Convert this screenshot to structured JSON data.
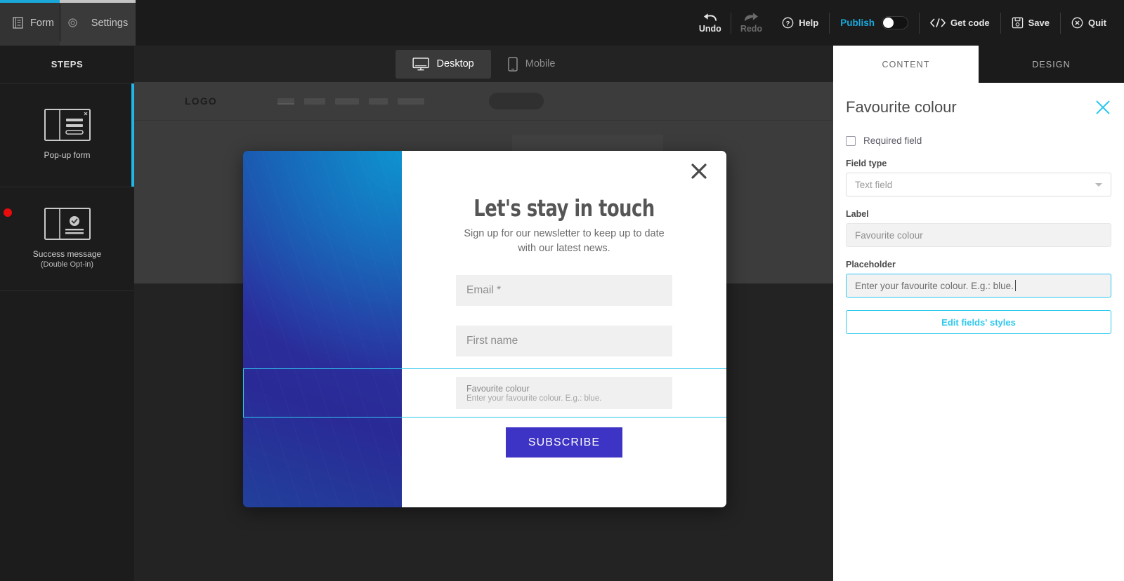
{
  "topbar": {
    "tabs": [
      {
        "label": "Form",
        "icon": "document-icon"
      },
      {
        "label": "Settings",
        "icon": "gear-icon"
      }
    ],
    "tools": [
      {
        "label": "Undo",
        "icon": "undo-arrow-icon"
      },
      {
        "label": "Redo",
        "icon": "redo-arrow-icon"
      },
      {
        "label": "Help",
        "icon": "help-circle-icon"
      },
      {
        "label": "Get code",
        "icon": "code-brackets-icon"
      },
      {
        "label": "Save",
        "icon": "floppy-disk-icon"
      },
      {
        "label": "Quit",
        "icon": "close-circle-icon"
      }
    ],
    "publish": {
      "label": "Publish",
      "state": "off"
    }
  },
  "sidebar": {
    "title": "STEPS",
    "items": [
      {
        "label": "Pop-up form",
        "sublabel": "",
        "icon": "popup-form-icon",
        "active": true,
        "has_alert": false
      },
      {
        "label": "Success message",
        "sublabel": "(Double Opt-in)",
        "icon": "success-check-icon",
        "active": false,
        "has_alert": true
      }
    ]
  },
  "canvas": {
    "device_switch": [
      {
        "label": "Desktop",
        "icon": "monitor-icon",
        "active": true
      },
      {
        "label": "Mobile",
        "icon": "phone-icon",
        "active": false
      }
    ],
    "mock_site": {
      "logo": "LOGO"
    }
  },
  "popup": {
    "title": "Let's stay in touch",
    "subtitle": "Sign up for our newsletter to keep up to date with our latest news.",
    "close_icon": "close-x-icon",
    "fields": [
      {
        "placeholder": "Email *",
        "label": "",
        "selected": false
      },
      {
        "placeholder": "First name",
        "label": "",
        "selected": false
      },
      {
        "placeholder": "Enter your favourite colour. E.g.: blue.",
        "label": "Favourite colour",
        "selected": true
      }
    ],
    "submit_label": "SUBSCRIBE"
  },
  "right_panel": {
    "tabs": [
      {
        "label": "CONTENT",
        "active": true
      },
      {
        "label": "DESIGN",
        "active": false
      }
    ],
    "heading": "Favourite colour",
    "close_icon": "close-x-icon",
    "required_checkbox": {
      "label": "Required field",
      "checked": false
    },
    "field_type": {
      "label": "Field type",
      "value": "Text field"
    },
    "label_field": {
      "label": "Label",
      "value": "Favourite colour"
    },
    "placeholder_field": {
      "label": "Placeholder",
      "value": "Enter your favourite colour. E.g.: blue."
    },
    "edit_styles_button": "Edit fields' styles"
  },
  "colors": {
    "accent_cyan": "#2ec8ef",
    "tab_cyan": "#1aa8db",
    "alert_red": "#e80c0c",
    "submit_purple": "#3d33c4"
  }
}
